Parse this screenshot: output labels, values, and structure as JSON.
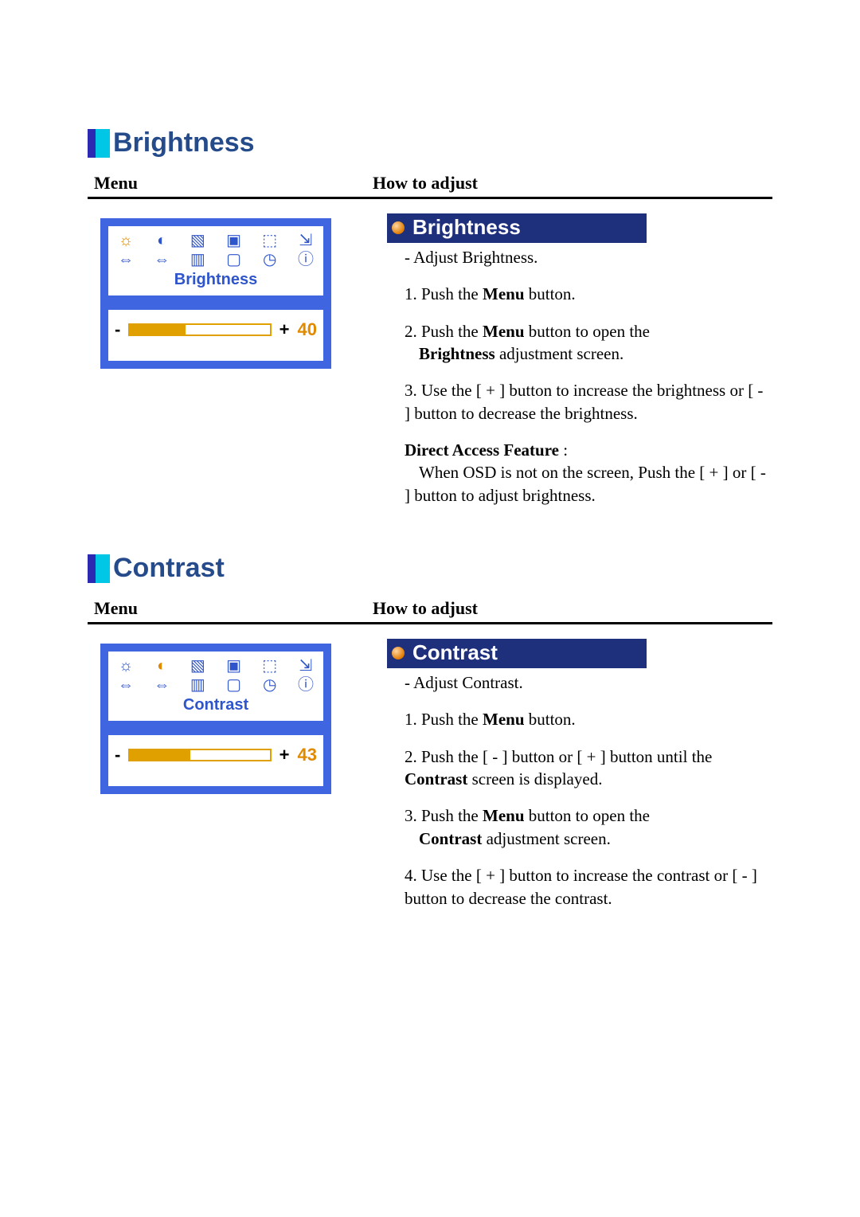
{
  "common": {
    "menu_header": "Menu",
    "howto_header": "How to adjust"
  },
  "sections": {
    "brightness": {
      "title": "Brightness",
      "osd": {
        "caption": "Brightness",
        "value": "40",
        "fill_pct": 40,
        "selected_icon": 0
      },
      "badge": "Brightness",
      "step0": "-  Adjust Brightness.",
      "step1_a": "1. Push the ",
      "step1_b": "Menu",
      "step1_c": " button.",
      "step2_a": "2. Push the ",
      "step2_b": "Menu",
      "step2_c": "  button to open the ",
      "step2_d": "Brightness",
      "step2_e": " adjustment screen.",
      "step3_a": "3. Use the ",
      "step3_b": "[ + ]",
      "step3_c": "  button to increase the brightness or ",
      "step3_d": "[ - ]",
      "step3_e": " button to decrease the brightness.",
      "daf_label": "Direct Access Feature",
      "daf_colon": " :",
      "daf_a": "When OSD is not on the screen, Push the ",
      "daf_b": "[ + ]",
      "daf_c": " or ",
      "daf_d": "[ - ]",
      "daf_e": " button to adjust brightness."
    },
    "contrast": {
      "title": "Contrast",
      "osd": {
        "caption": "Contrast",
        "value": "43",
        "fill_pct": 43,
        "selected_icon": 1
      },
      "badge": "Contrast",
      "step0": "-  Adjust Contrast.",
      "step1_a": "1. Push the ",
      "step1_b": "Menu",
      "step1_c": " button.",
      "step2_a": "2. Push the ",
      "step2_b": "[ - ]",
      "step2_c": "  button or ",
      "step2_d": "[ + ]",
      "step2_e": "  button until the ",
      "step2_f": "Contrast",
      "step2_g": " screen is displayed.",
      "step3_a": "3. Push the ",
      "step3_b": "Menu",
      "step3_c": "  button to open the ",
      "step3_d": "Contrast",
      "step3_e": " adjustment screen.",
      "step4_a": "4. Use the ",
      "step4_b": "[ + ]",
      "step4_c": "  button to increase the contrast  or ",
      "step4_d": "[ - ]",
      "step4_e": " button to decrease the contrast."
    }
  },
  "osd_icons_top": [
    "☼",
    "◐",
    "▧",
    "▣",
    "⬚",
    "⇲"
  ],
  "osd_icons_bottom": [
    "⇔",
    "⇔",
    "▥",
    "▢",
    "◷",
    "ⓘ"
  ]
}
